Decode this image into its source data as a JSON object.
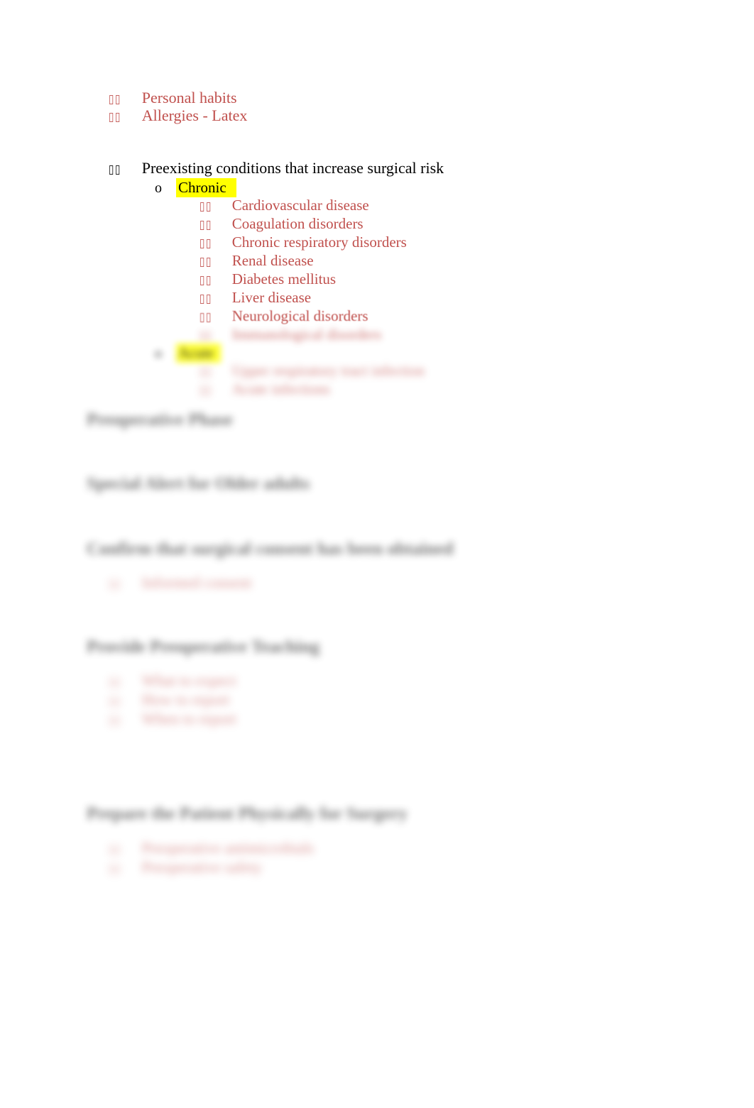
{
  "document": {
    "page_background": "#ffffff",
    "body_text_color": "#000000",
    "accent_red": "#C0504D",
    "heading_color": "#3F3F3F",
    "highlight_color": "#FFFF00"
  },
  "outline": {
    "top_items": [
      {
        "marker": "box-bullet",
        "label": "Personal habits",
        "color": "#C0504D"
      },
      {
        "marker": "box-bullet",
        "label": "Allergies - Latex",
        "color": "#C0504D"
      }
    ],
    "preexisting": {
      "marker": "box-bullet",
      "label": "Preexisting conditions that increase surgical risk",
      "color": "#000000",
      "groups": [
        {
          "marker": "o",
          "label": "Chronic",
          "highlighted": true,
          "items": [
            {
              "marker": "box-bullet",
              "label": "Cardiovascular disease"
            },
            {
              "marker": "box-bullet",
              "label": "Coagulation disorders"
            },
            {
              "marker": "box-bullet",
              "label": "Chronic respiratory disorders"
            },
            {
              "marker": "box-bullet",
              "label": "Renal disease"
            },
            {
              "marker": "box-bullet",
              "label": "Diabetes mellitus"
            },
            {
              "marker": "box-bullet",
              "label": "Liver disease"
            },
            {
              "marker": "box-bullet",
              "label": "Neurological disorders"
            },
            {
              "marker": "box-bullet",
              "label": "Immunological disorders"
            }
          ]
        },
        {
          "marker": "o",
          "label": "Acute",
          "highlighted": true,
          "items": [
            {
              "marker": "box-bullet",
              "label": "Upper respiratory tract infection"
            },
            {
              "marker": "box-bullet",
              "label": "Acute infections"
            }
          ]
        }
      ]
    }
  },
  "sections": [
    {
      "heading": "Preoperative Phase",
      "bullets": []
    },
    {
      "heading": "Special Alert for Older adults",
      "bullets": []
    },
    {
      "heading": "Confirm that surgical consent has been obtained",
      "bullets": [
        {
          "marker": "box-bullet",
          "label": "Informed consent"
        }
      ]
    },
    {
      "heading": "Provide Preoperative Teaching",
      "bullets": [
        {
          "marker": "box-bullet",
          "label": "What to expect"
        },
        {
          "marker": "box-bullet",
          "label": "How to report"
        },
        {
          "marker": "box-bullet",
          "label": "When to report"
        }
      ]
    },
    {
      "heading": "Prepare the Patient Physically for Surgery",
      "bullets": [
        {
          "marker": "box-bullet",
          "label": "Preoperative antimicrobials"
        },
        {
          "marker": "box-bullet",
          "label": "Preoperative safety"
        }
      ]
    }
  ]
}
